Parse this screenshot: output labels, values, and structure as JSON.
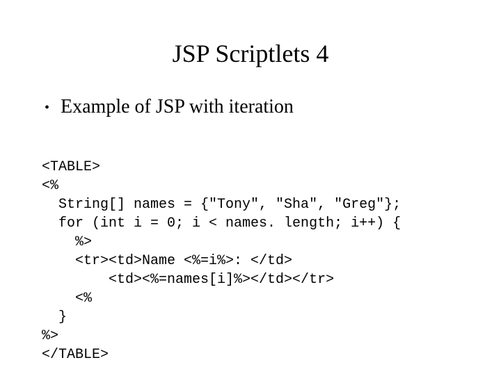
{
  "title": "JSP Scriptlets 4",
  "bullets": {
    "b0": "Example of JSP with iteration"
  },
  "code": {
    "l0": "<TABLE>",
    "l1": "<%",
    "l2": "  String[] names = {\"Tony\", \"Sha\", \"Greg\"};",
    "l3": "  for (int i = 0; i < names. length; i++) {",
    "l4": "    %>",
    "l5": "    <tr><td>Name <%=i%>: </td>",
    "l6": "        <td><%=names[i]%></td></tr>",
    "l7": "    <%",
    "l8": "  }",
    "l9": "%>",
    "l10": "</TABLE>"
  }
}
